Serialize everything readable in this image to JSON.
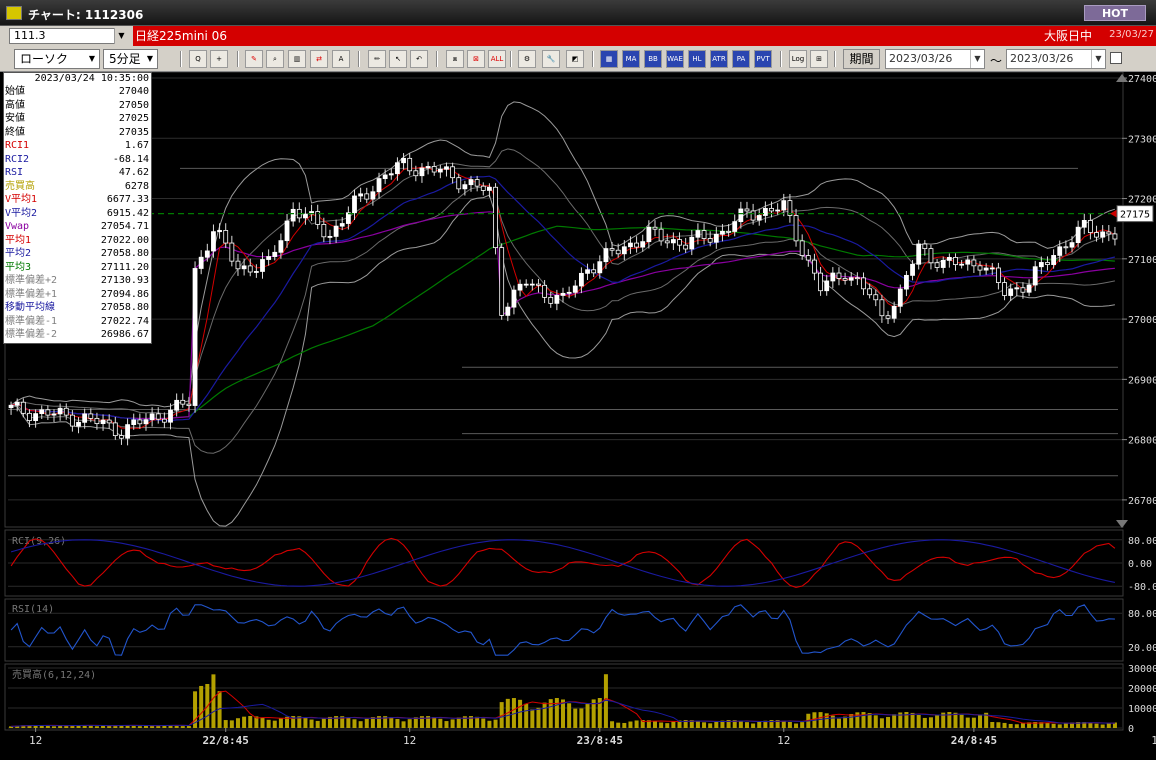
{
  "window": {
    "title": "チャート: 1112306",
    "hot_label": "HOT"
  },
  "symbol_bar": {
    "code": "111.3",
    "name": "日経225mini 06",
    "market": "大阪日中",
    "date": "23/03/27"
  },
  "toolbar": {
    "chart_type": "ローソク",
    "interval": "5分足",
    "buttons": [
      {
        "name": "zoom-icon",
        "text": "Q",
        "style": ""
      },
      {
        "name": "crosshair-icon",
        "text": "+",
        "style": ""
      },
      {
        "name": "draw-icon",
        "text": "✎",
        "style": "red"
      },
      {
        "name": "search-icon",
        "text": "⌕",
        "style": ""
      },
      {
        "name": "bar-chart-icon",
        "text": "▥",
        "style": ""
      },
      {
        "name": "arrows-icon",
        "text": "⇄",
        "style": "red"
      },
      {
        "name": "text-icon",
        "text": "A",
        "style": ""
      },
      {
        "name": "pencil-icon",
        "text": "✏",
        "style": ""
      },
      {
        "name": "pointer-icon",
        "text": "↖",
        "style": ""
      },
      {
        "name": "undo-icon",
        "text": "↶",
        "style": ""
      },
      {
        "name": "candle-icon",
        "text": "⧈",
        "style": ""
      },
      {
        "name": "candle-delete-icon",
        "text": "⊠",
        "style": "red"
      },
      {
        "name": "all-icon",
        "text": "ALL",
        "style": "red"
      },
      {
        "name": "gear-icon",
        "text": "⚙",
        "style": ""
      },
      {
        "name": "wrench-icon",
        "text": "🔧",
        "style": ""
      },
      {
        "name": "palette-icon",
        "text": "◩",
        "style": ""
      },
      {
        "name": "table-icon",
        "text": "▦",
        "style": "blue"
      }
    ],
    "indicator_buttons": [
      "MA",
      "BB",
      "WAE",
      "HL",
      "ATR",
      "PA",
      "PVT"
    ],
    "log_label": "Log",
    "period_label": "期間",
    "date_from": "2023/03/26",
    "date_to": "2023/03/26",
    "tilde": "～"
  },
  "info_panel": {
    "datetime": "2023/03/24  10:35:00",
    "rows": [
      {
        "label": "始値",
        "value": "27040",
        "color": "#000000"
      },
      {
        "label": "高値",
        "value": "27050",
        "color": "#000000"
      },
      {
        "label": "安値",
        "value": "27025",
        "color": "#000000"
      },
      {
        "label": "終値",
        "value": "27035",
        "color": "#000000"
      },
      {
        "label": "RCI1",
        "value": "1.67",
        "color": "#d40000"
      },
      {
        "label": "RCI2",
        "value": "-68.14",
        "color": "#1a1aa0"
      },
      {
        "label": "RSI",
        "value": "47.62",
        "color": "#1a1aa0"
      },
      {
        "label": "売買高",
        "value": "6278",
        "color": "#b3a000"
      },
      {
        "label": "V平均1",
        "value": "6677.33",
        "color": "#d40000"
      },
      {
        "label": "V平均2",
        "value": "6915.42",
        "color": "#1a1aa0"
      },
      {
        "label": "Vwap",
        "value": "27054.71",
        "color": "#8a00a0"
      },
      {
        "label": "平均1",
        "value": "27022.00",
        "color": "#d40000"
      },
      {
        "label": "平均2",
        "value": "27058.80",
        "color": "#1a1aa0"
      },
      {
        "label": "平均3",
        "value": "27111.20",
        "color": "#007a00"
      },
      {
        "label": "標準偏差+2",
        "value": "27130.93",
        "color": "#808080"
      },
      {
        "label": "標準偏差+1",
        "value": "27094.86",
        "color": "#808080"
      },
      {
        "label": "移動平均線",
        "value": "27058.80",
        "color": "#1a1aa0"
      },
      {
        "label": "標準偏差-1",
        "value": "27022.74",
        "color": "#808080"
      },
      {
        "label": "標準偏差-2",
        "value": "26986.67",
        "color": "#808080"
      }
    ]
  },
  "price_axis": {
    "ticks": [
      "27400",
      "27300",
      "27200",
      "27100",
      "27000",
      "26900",
      "26800",
      "26700"
    ],
    "current_price": "27175",
    "current_value": 27175,
    "ylim": [
      26655,
      27410
    ]
  },
  "x_axis": {
    "labels": [
      {
        "text": "12",
        "bar": 4
      },
      {
        "text": "22/8:45",
        "bar": 35
      },
      {
        "text": "12",
        "bar": 65
      },
      {
        "text": "23/8:45",
        "bar": 96
      },
      {
        "text": "12",
        "bar": 126
      },
      {
        "text": "24/8:45",
        "bar": 157
      },
      {
        "text": "12",
        "bar": 187
      }
    ]
  },
  "panels": {
    "rci": {
      "title": "RCI(9,26)",
      "ticks": [
        "80.00",
        "0.00",
        "-80.00"
      ]
    },
    "rsi": {
      "title": "RSI(14)",
      "ticks": [
        "80.00",
        "20.00"
      ]
    },
    "volume": {
      "title": "売買高(6,12,24)",
      "ticks": [
        "30000",
        "20000",
        "10000",
        "0"
      ]
    }
  },
  "colors": {
    "candle_up": "#ffffff",
    "candle_down": "#ffffff",
    "ma1": "#d40000",
    "ma2": "#1a1aa0",
    "ma3": "#007a00",
    "vwap": "#8a00a0",
    "band": "#9a9a9a",
    "volume": "#b3a000",
    "rci1": "#d40000",
    "rci2": "#1a1aa0",
    "rsi": "#2255cc",
    "current_line": "#007a00"
  },
  "chart_data": {
    "type": "line",
    "title": "日経225mini 06 5分足",
    "x_labels": [
      "12",
      "22/8:45",
      "12",
      "23/8:45",
      "12",
      "24/8:45",
      "12"
    ],
    "close_anchors": [
      {
        "bar": 0,
        "y": 26850
      },
      {
        "bar": 12,
        "y": 26835
      },
      {
        "bar": 18,
        "y": 26815
      },
      {
        "bar": 24,
        "y": 26840
      },
      {
        "bar": 29,
        "y": 26860
      },
      {
        "bar": 30,
        "y": 27080
      },
      {
        "bar": 33,
        "y": 27150
      },
      {
        "bar": 37,
        "y": 27085
      },
      {
        "bar": 42,
        "y": 27090
      },
      {
        "bar": 46,
        "y": 27185
      },
      {
        "bar": 52,
        "y": 27140
      },
      {
        "bar": 56,
        "y": 27190
      },
      {
        "bar": 61,
        "y": 27240
      },
      {
        "bar": 64,
        "y": 27255
      },
      {
        "bar": 70,
        "y": 27245
      },
      {
        "bar": 78,
        "y": 27210
      },
      {
        "bar": 80,
        "y": 27020
      },
      {
        "bar": 84,
        "y": 27060
      },
      {
        "bar": 90,
        "y": 27030
      },
      {
        "bar": 94,
        "y": 27085
      },
      {
        "bar": 100,
        "y": 27120
      },
      {
        "bar": 104,
        "y": 27140
      },
      {
        "bar": 110,
        "y": 27125
      },
      {
        "bar": 116,
        "y": 27145
      },
      {
        "bar": 120,
        "y": 27175
      },
      {
        "bar": 126,
        "y": 27185
      },
      {
        "bar": 128,
        "y": 27140
      },
      {
        "bar": 132,
        "y": 27050
      },
      {
        "bar": 136,
        "y": 27080
      },
      {
        "bar": 140,
        "y": 27040
      },
      {
        "bar": 142,
        "y": 27005
      },
      {
        "bar": 145,
        "y": 27040
      },
      {
        "bar": 148,
        "y": 27120
      },
      {
        "bar": 152,
        "y": 27090
      },
      {
        "bar": 158,
        "y": 27095
      },
      {
        "bar": 162,
        "y": 27045
      },
      {
        "bar": 166,
        "y": 27060
      },
      {
        "bar": 170,
        "y": 27110
      },
      {
        "bar": 175,
        "y": 27150
      },
      {
        "bar": 180,
        "y": 27140
      }
    ],
    "ylim": [
      26655,
      27410
    ],
    "rci_ylim": [
      -100,
      100
    ],
    "rsi_ylim": [
      0,
      100
    ],
    "volume_ylim": [
      0,
      30000
    ]
  }
}
